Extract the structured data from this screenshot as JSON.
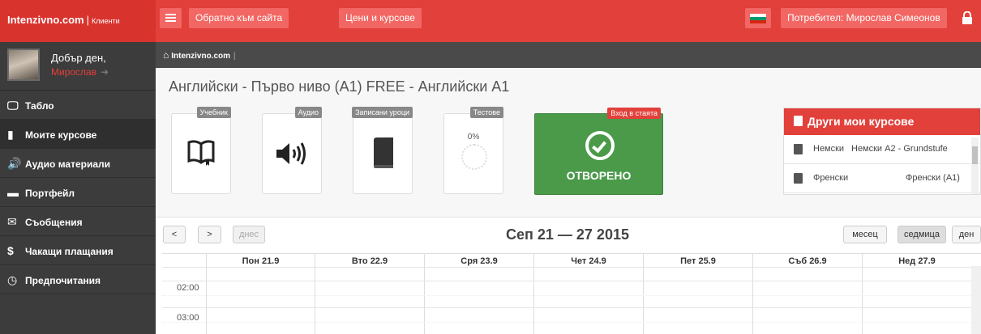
{
  "topbar": {
    "brand": "Intenzivno.com",
    "brand_sep": "|",
    "brand_sub": "Клиенти",
    "back_button": "Обратно към сайта",
    "prices_button": "Цени и курсове",
    "user_button": "Потребител: Мирослав Симеонов",
    "flag_colors": [
      "#ffffff",
      "#00966e",
      "#d62612"
    ],
    "accent_color": "#e2403b"
  },
  "sidebar": {
    "greeting": "Добър ден,",
    "user_name": "Мирослав",
    "items": [
      {
        "icon": "monitor-icon",
        "label": "Табло"
      },
      {
        "icon": "book-icon",
        "label": "Моите курсове"
      },
      {
        "icon": "volume-icon",
        "label": "Аудио материали"
      },
      {
        "icon": "briefcase-icon",
        "label": "Портфейл"
      },
      {
        "icon": "envelope-icon",
        "label": "Съобщения"
      },
      {
        "icon": "dollar-icon",
        "label": "Чакащи плащания"
      },
      {
        "icon": "clock-icon",
        "label": "Предпочитания"
      }
    ]
  },
  "breadcrumb": {
    "home": "Intenzivno.com"
  },
  "course": {
    "title": "Английски - Първо ниво (A1) FREE - Английски A1",
    "tiles": [
      {
        "label": "Учебник",
        "icon": "open-book-icon"
      },
      {
        "label": "Аудио",
        "icon": "speaker-icon"
      },
      {
        "label": "Записани уроци",
        "icon": "book-icon"
      },
      {
        "label": "Тестове",
        "value": "0%",
        "icon": "progress-dial-icon"
      }
    ],
    "room": {
      "label": "Вход в стаята",
      "status": "ОТВОРЕНО"
    }
  },
  "other_courses": {
    "title": "Други мои курсове",
    "items": [
      {
        "language": "Немски",
        "course": "Немски A2 - Grundstufe"
      },
      {
        "language": "Френски",
        "course": "Френски (A1)"
      }
    ]
  },
  "calendar": {
    "prev": "<",
    "next": ">",
    "today": "днес",
    "range": "Сеп 21 — 27 2015",
    "views": [
      "месец",
      "седмица",
      "ден"
    ],
    "active_view": "седмица",
    "days": [
      "Пон 21.9",
      "Вто 22.9",
      "Сря 23.9",
      "Чет 24.9",
      "Пет 25.9",
      "Съб 26.9",
      "Нед 27.9"
    ],
    "times": [
      "02:00",
      "03:00"
    ]
  }
}
